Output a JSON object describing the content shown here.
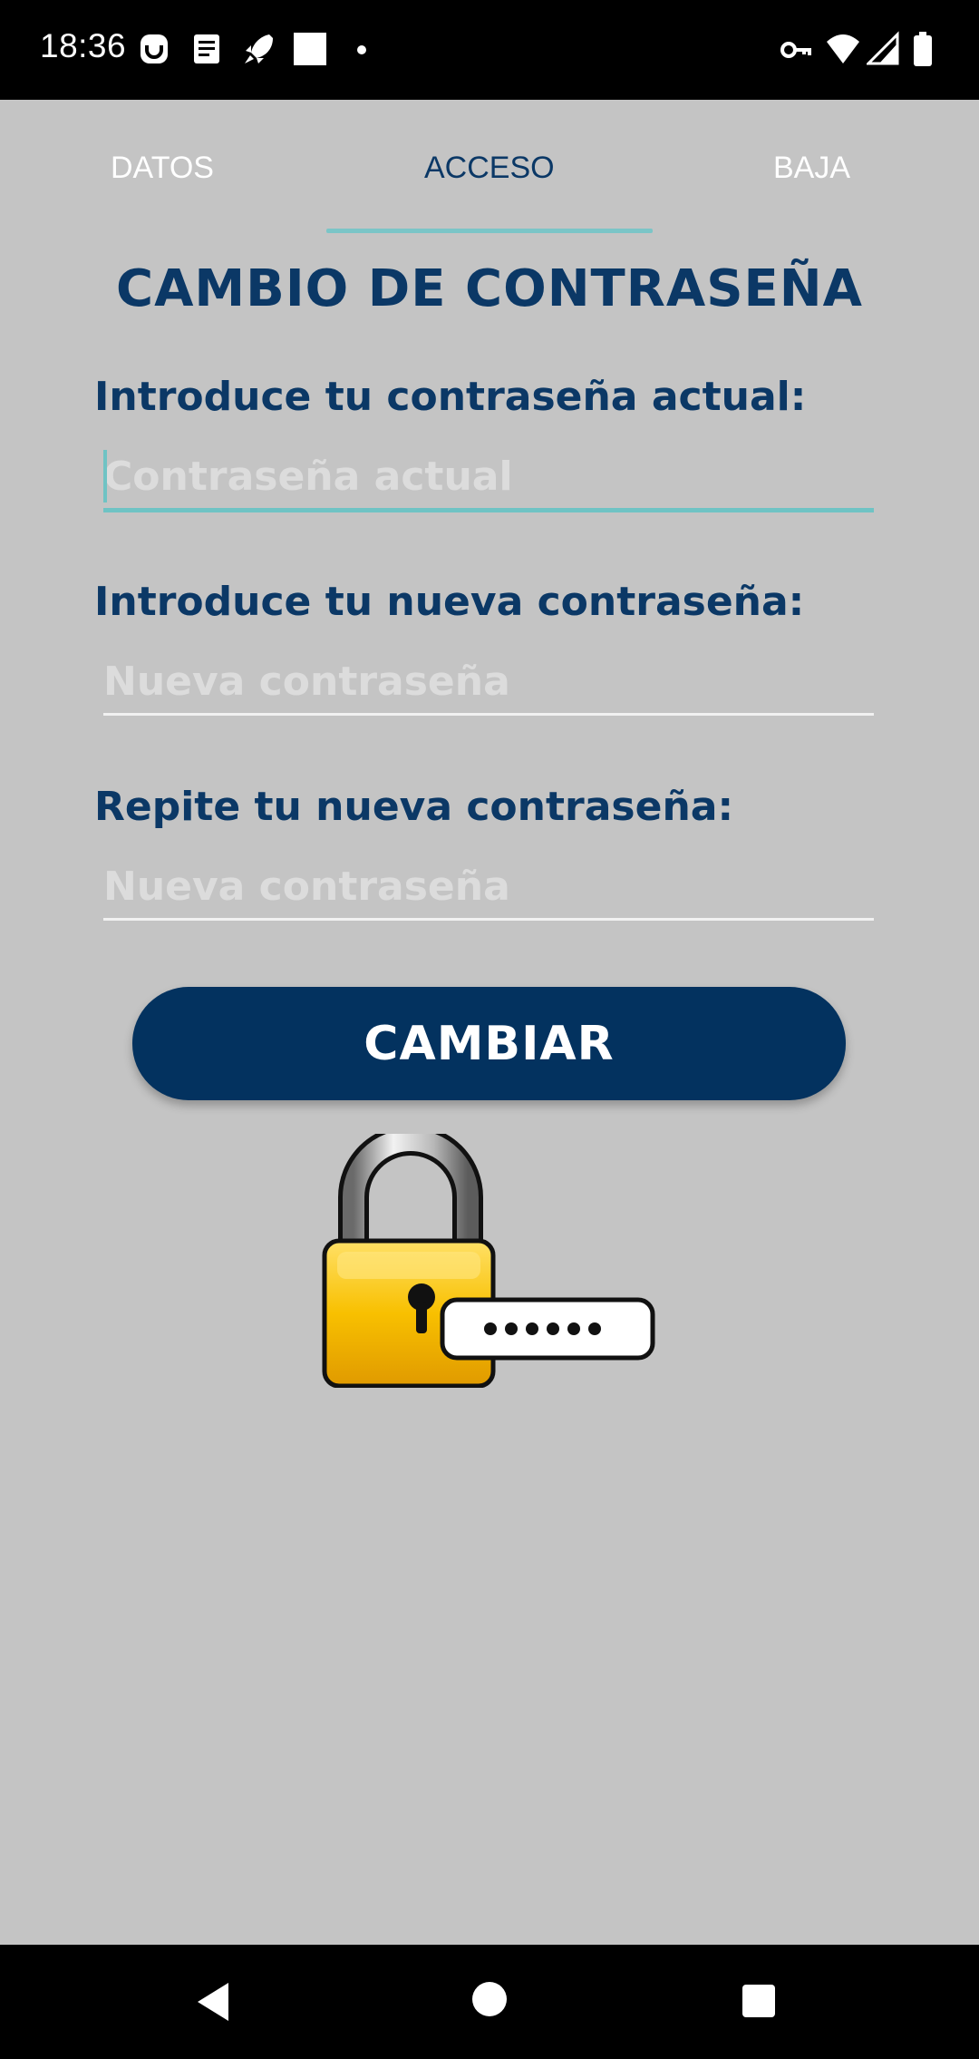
{
  "status_bar": {
    "time": "18:36",
    "icons_left": [
      "app-notification-icon",
      "document-icon",
      "rocket-icon",
      "square-icon",
      "dot-icon"
    ],
    "icons_right": [
      "vpn-key-icon",
      "wifi-icon",
      "signal-icon",
      "battery-icon"
    ]
  },
  "tabs": [
    {
      "label": "DATOS",
      "active": false
    },
    {
      "label": "ACCESO",
      "active": true
    },
    {
      "label": "BAJA",
      "active": false
    }
  ],
  "form": {
    "title": "CAMBIO DE CONTRASEÑA",
    "current": {
      "label": "Introduce tu contraseña actual:",
      "placeholder": "Contraseña actual",
      "value": ""
    },
    "new": {
      "label": "Introduce tu nueva contraseña:",
      "placeholder": "Nueva contraseña",
      "value": ""
    },
    "repeat": {
      "label": "Repite tu nueva contraseña:",
      "placeholder": "Nueva contraseña",
      "value": ""
    },
    "submit_label": "CAMBIAR"
  },
  "colors": {
    "primary": "#03325f",
    "accent": "#6fc3c4",
    "background": "#c4c4c4"
  },
  "nav_bar": [
    "back-icon",
    "home-icon",
    "recents-icon"
  ]
}
